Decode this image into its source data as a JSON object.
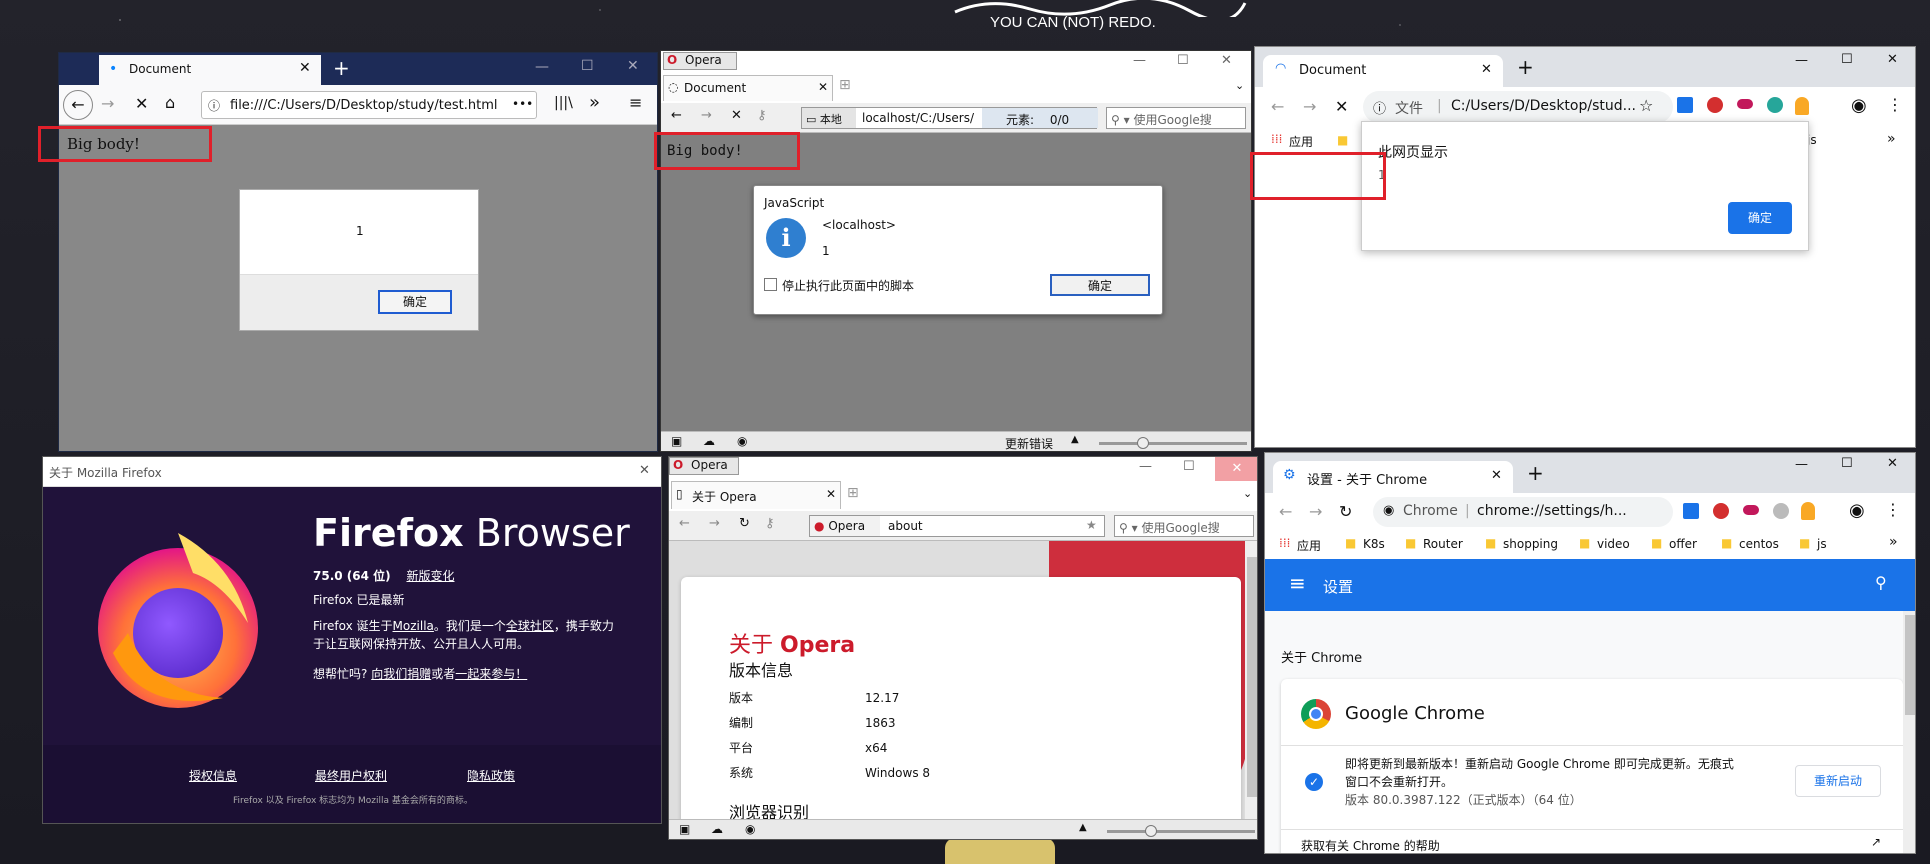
{
  "banner": {
    "subtitle": "YOU CAN (NOT) REDO."
  },
  "ff": {
    "tab_title": "Document",
    "url": "file:///C:/Users/D/Desktop/study/test.html",
    "more": "•••",
    "library": "|||\\",
    "overflow": "»",
    "body_text": "Big body!",
    "alert_msg": "1",
    "ok": "确定"
  },
  "op1": {
    "menu": "Opera",
    "tab_title": "Document",
    "local": "本地",
    "url": "localhost/C:/Users/",
    "elements_label": "元素:",
    "elements_val": "0/0",
    "search": "使用Google搜",
    "body_text": "Big body!",
    "dlg_title": "JavaScript",
    "dlg_origin": "<localhost>",
    "dlg_msg": "1",
    "dlg_checkbox": "停止执行此页面中的脚本",
    "ok": "确定",
    "status": "更新错误"
  },
  "cr1": {
    "tab_title": "Document",
    "file_label": "文件",
    "url": "C:/Users/D/Desktop/stud...",
    "apps": "应用",
    "bm_js": "js",
    "dlg_title": "此网页显示",
    "dlg_msg": "1",
    "ok": "确定"
  },
  "about_ff": {
    "title": "关于 Mozilla Firefox",
    "brand_a": "Firefox",
    "brand_b": "Browser",
    "version": "75.0 (64 位)",
    "whatsnew": "新版变化",
    "uptodate": "Firefox 已是最新",
    "desc_1": "Firefox 诞生于",
    "mozilla": "Mozilla",
    "desc_2": "。我们是一个",
    "community": "全球社区",
    "desc_3": "，携手致力",
    "desc_4": "于让互联网保持开放、公开且人人可用。",
    "help_q": "想帮忙吗?",
    "donate": "向我们捐赠",
    "or": "或者",
    "join": "一起来参与！",
    "license": "授权信息",
    "eula": "最终用户权利",
    "privacy": "隐私政策",
    "trademark": "Firefox 以及 Firefox 标志均为 Mozilla 基金会所有的商标。"
  },
  "op2": {
    "menu": "Opera",
    "tab_title": "关于 Opera",
    "brand": "Opera",
    "url": "about",
    "search": "使用Google搜",
    "heading_a": "关于",
    "heading_b": "Opera",
    "version_info": "版本信息",
    "rows": [
      {
        "k": "版本",
        "v": "12.17"
      },
      {
        "k": "编制",
        "v": "1863"
      },
      {
        "k": "平台",
        "v": "x64"
      },
      {
        "k": "系统",
        "v": "Windows 8"
      }
    ],
    "browser_id": "浏览器识别"
  },
  "cr2": {
    "tab_title": "设置 - 关于 Chrome",
    "site": "Chrome",
    "url": "chrome://settings/h...",
    "bookmarks": [
      "应用",
      "K8s",
      "Router",
      "shopping",
      "video",
      "offer",
      "centos",
      "js"
    ],
    "header": "设置",
    "section": "关于 Chrome",
    "product": "Google Chrome",
    "update_msg_1": "即将更新到最新版本！重新启动 Google Chrome 即可完成更新。无痕式",
    "update_msg_2": "窗口不会重新打开。",
    "version": "版本 80.0.3987.122（正式版本）（64 位）",
    "relaunch": "重新启动",
    "help": "获取有关 Chrome 的帮助"
  },
  "colors": {
    "red_box": "#e0202a",
    "chrome_blue": "#1a73e8",
    "ff_purple": "#20123a",
    "opera_red": "#cc1b2b"
  }
}
